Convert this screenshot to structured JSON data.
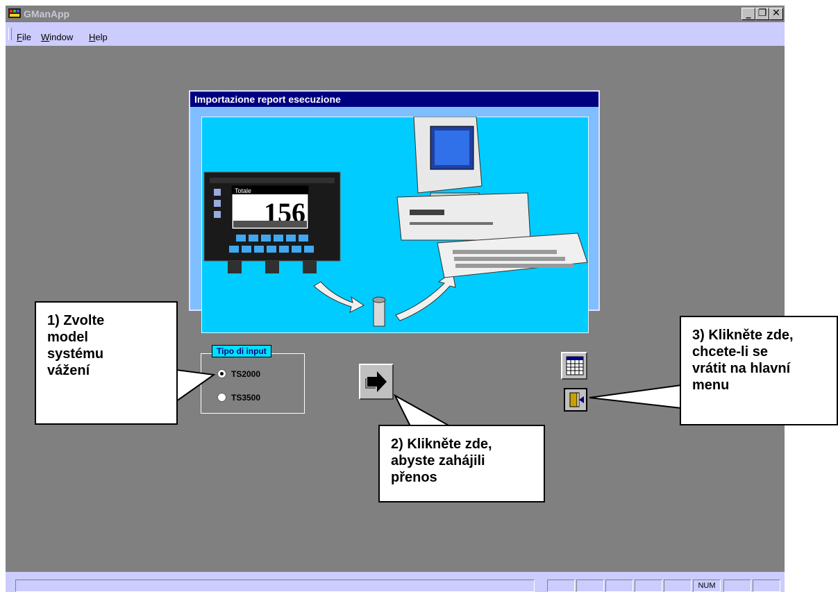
{
  "window": {
    "title": "GManApp"
  },
  "menu": {
    "items": [
      "File",
      "Window",
      "Help"
    ]
  },
  "statusbar": {
    "num_label": "NUM"
  },
  "dialog": {
    "title": "Importazione report esecuzione",
    "display_value": "156",
    "display_label": "Totale",
    "input_group": {
      "title": "Tipo di input",
      "options": [
        "TS2000",
        "TS3500"
      ],
      "selected": "TS2000"
    }
  },
  "callouts": {
    "c1": "1) Zvolte\nmodel\nsystému\nvážení",
    "c2": "2) Klikněte zde,\nabyste zahájili\npřenos",
    "c3": "3) Klikněte zde,\nchcete-li se\nvrátit na hlavní\nmenu"
  },
  "colors": {
    "dialog_bg": "#7fbfff",
    "title_bg": "#000080",
    "illustration_bg": "#00ccff",
    "accent": "#00e0ff"
  }
}
